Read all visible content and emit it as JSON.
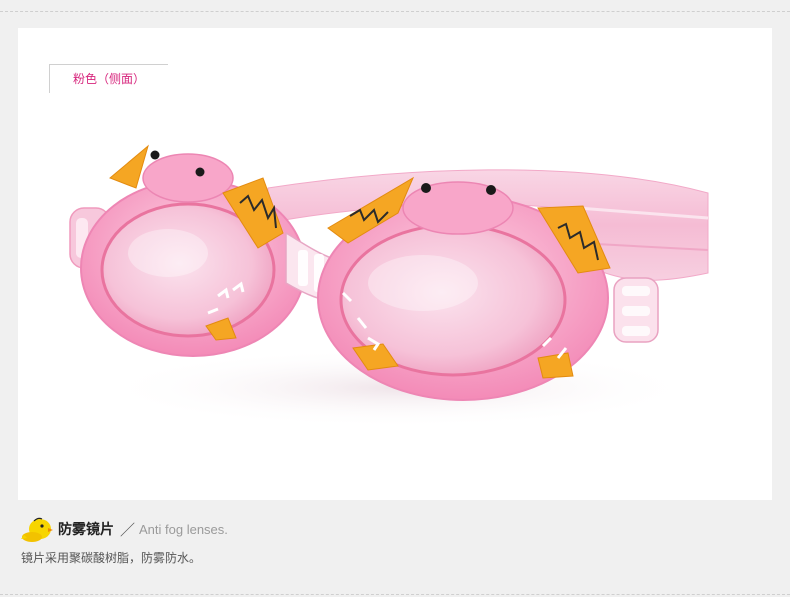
{
  "color_tag": "粉色（侧面）",
  "feature": {
    "title": "防雾镜片",
    "slash": "／",
    "english": "Anti fog lenses.",
    "description": "镜片采用聚碳酸树脂，防雾防水。"
  },
  "icons": {
    "feature_icon": "duck-mascot-icon"
  },
  "colors": {
    "goggle_frame": "#f7a6c8",
    "strap": "#f6c6da",
    "fin_accent": "#f5a623",
    "tag_text": "#d7267d"
  }
}
